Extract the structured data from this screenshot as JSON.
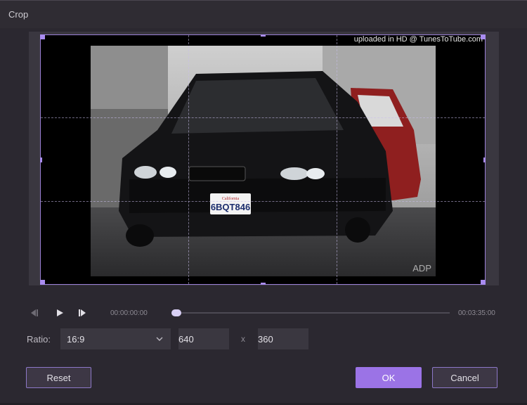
{
  "window": {
    "title": "Crop"
  },
  "preview": {
    "watermark": "uploaded in HD @ TunesToTube.com",
    "photo_mark": "ADP",
    "plate_text": "6BQT846",
    "plate_state": "California"
  },
  "playback": {
    "current_time": "00:00:00:00",
    "total_time": "00:03:35:00",
    "progress": 0.0
  },
  "ratio": {
    "label": "Ratio:",
    "selected": "16:9",
    "width": "640",
    "times": "x",
    "height": "360"
  },
  "buttons": {
    "reset": "Reset",
    "ok": "OK",
    "cancel": "Cancel"
  },
  "colors": {
    "accent": "#9b73e6",
    "frame": "#9a7fd6",
    "background": "#2b2830"
  },
  "icons": [
    "prev-frame-icon",
    "play-icon",
    "next-frame-icon",
    "chevron-down-icon"
  ]
}
